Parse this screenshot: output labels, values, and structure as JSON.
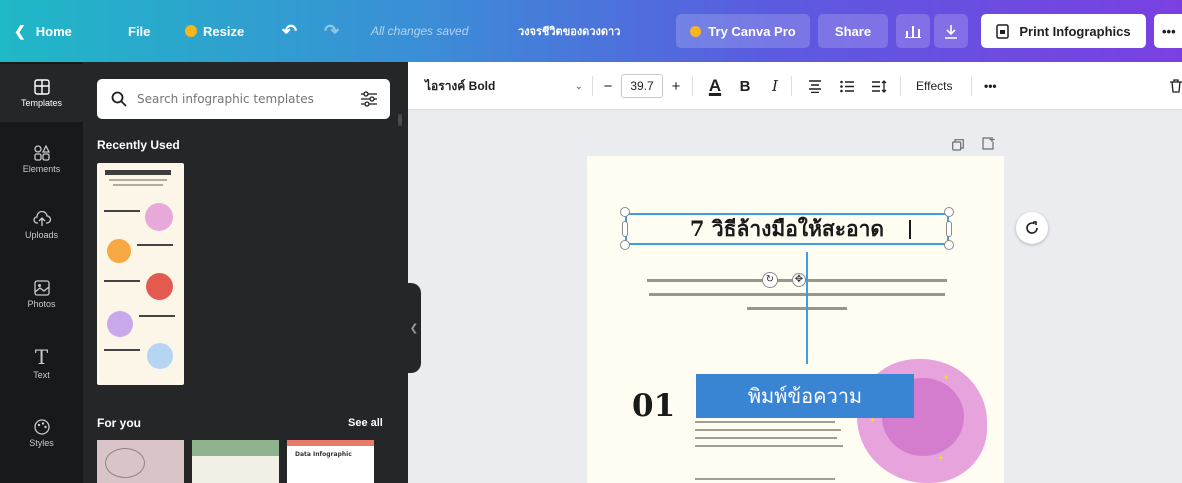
{
  "topbar": {
    "home": "Home",
    "file": "File",
    "resize": "Resize",
    "save_status": "All changes saved",
    "doc_title": "วงจรชีวิตของดวงดาว",
    "try_pro": "Try Canva Pro",
    "share": "Share",
    "print": "Print Infographics",
    "more": "•••"
  },
  "rail": {
    "items": [
      {
        "label": "Templates",
        "icon": "templates-icon"
      },
      {
        "label": "Elements",
        "icon": "elements-icon"
      },
      {
        "label": "Uploads",
        "icon": "uploads-icon"
      },
      {
        "label": "Photos",
        "icon": "photos-icon"
      },
      {
        "label": "Text",
        "icon": "text-icon"
      },
      {
        "label": "Styles",
        "icon": "styles-icon"
      }
    ]
  },
  "panel": {
    "search_placeholder": "Search infographic templates",
    "recently_used": "Recently Used",
    "for_you": "For you",
    "see_all": "See all",
    "thumbs": [
      "Data Infographic"
    ]
  },
  "toolbar": {
    "font": "ไอรางค์ Bold",
    "font_size": "39.7",
    "minus": "−",
    "plus": "+",
    "color_letter": "A",
    "bold": "B",
    "italic": "I",
    "effects": "Effects",
    "more": "•••"
  },
  "canvas": {
    "title": "7 วิธีล้างมือให้สะอาด",
    "number": "01",
    "callout": "พิมพ์ข้อความ"
  },
  "colors": {
    "gradient_start": "#1fb8c6",
    "gradient_end": "#7a3fe2",
    "pro_crown": "#f7b51f",
    "selection": "#3c9ee0",
    "callout_bg": "#3a84d4",
    "canvas_bg": "#fffcf2"
  }
}
